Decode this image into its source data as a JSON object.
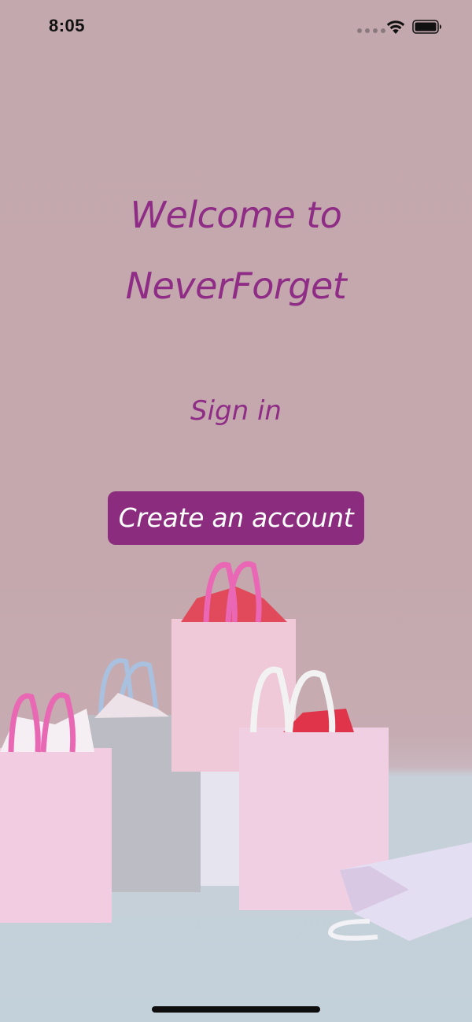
{
  "status_bar": {
    "time": "8:05"
  },
  "welcome": {
    "line1": "Welcome to",
    "line2": "NeverForget"
  },
  "actions": {
    "sign_in_label": "Sign in",
    "create_account_label": "Create an account"
  },
  "colors": {
    "accent": "#8e2c86",
    "button_bg": "#8b2c7f",
    "button_text": "#ffffff",
    "background_wall": "#c3a8ae",
    "background_floor": "#c3d1da"
  },
  "icons": {
    "signal": "cellular-signal-icon",
    "wifi": "wifi-icon",
    "battery": "battery-icon"
  }
}
